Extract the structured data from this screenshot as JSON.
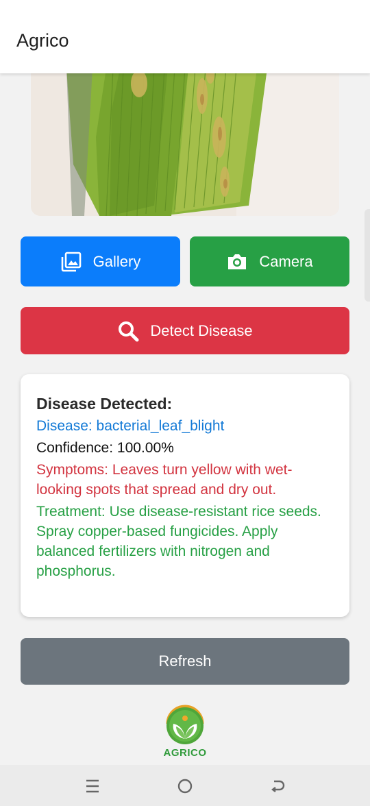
{
  "app_bar": {
    "title": "Agrico"
  },
  "image": {
    "subject": "rice-leaf-photo"
  },
  "buttons": {
    "gallery": "Gallery",
    "camera": "Camera",
    "detect": "Detect Disease",
    "refresh": "Refresh"
  },
  "result": {
    "heading": "Disease Detected:",
    "disease": "Disease: bacterial_leaf_blight",
    "confidence": "Confidence: 100.00%",
    "symptoms": "Symptoms: Leaves turn yellow with wet-looking spots that spread and dry out.",
    "treatment": "Treatment: Use disease-resistant rice seeds. Spray copper-based fungicides. Apply balanced fertilizers with nitrogen and phosphorus."
  },
  "logo": {
    "text": "AGRICO"
  },
  "nav": {
    "icons": [
      "recent-apps-icon",
      "home-icon",
      "back-icon"
    ]
  },
  "colors": {
    "gallery": "#0b7dfb",
    "camera": "#27a045",
    "detect": "#dc3545",
    "refresh": "#6c757d",
    "disease_text": "#1279d6",
    "symptoms_text": "#d2333f",
    "treatment_text": "#27a045"
  }
}
